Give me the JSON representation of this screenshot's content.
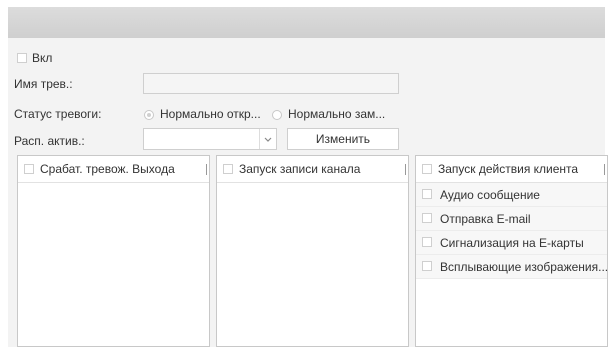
{
  "enable": {
    "label": "Вкл"
  },
  "alarm_name": {
    "label": "Имя трев.:",
    "value": ""
  },
  "alarm_status": {
    "label": "Статус тревоги:",
    "options": [
      "Нормально откр...",
      "Нормально зам..."
    ],
    "selected": 0
  },
  "schedule": {
    "label": "Расп. актив.:",
    "value": "",
    "edit_label": "Изменить"
  },
  "columns": [
    {
      "header": "Срабат. тревож. Выхода",
      "items": []
    },
    {
      "header": "Запуск записи канала",
      "items": []
    },
    {
      "header": "Запуск действия клиента",
      "items": [
        "Аудио сообщение",
        "Отправка E-mail",
        "Сигнализация на E-карты",
        "Всплывающие изображения..."
      ]
    }
  ]
}
